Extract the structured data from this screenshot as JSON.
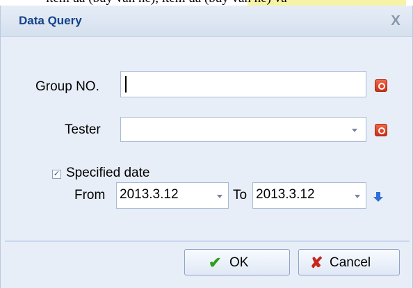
{
  "background_text": "ltem ua (buy van ne), ltem ua (buy van ne) va",
  "dialog": {
    "title": "Data Query",
    "close_glyph": "X"
  },
  "form": {
    "group_no": {
      "label": "Group NO.",
      "value": "",
      "clear_icon": "clear-icon"
    },
    "tester": {
      "label": "Tester",
      "value": "",
      "dropdown_icon": "chevron-down-icon",
      "clear_icon": "clear-icon"
    },
    "specified_date": {
      "label": "Specified date",
      "checked": true,
      "check_glyph": "✓",
      "from_label": "From",
      "from_value": "2013.3.12",
      "to_label": "To",
      "to_value": "2013.3.12",
      "apply_icon": "arrow-down-icon"
    }
  },
  "footer": {
    "ok_label": "OK",
    "ok_glyph": "✔",
    "cancel_label": "Cancel",
    "cancel_glyph": "✘"
  },
  "colors": {
    "title": "#15428b",
    "dialog_bg": "#e8eef7",
    "clear_button": "#e0452a",
    "ok_check": "#2e9e1a",
    "cancel_x": "#c8261b",
    "separator": "#8fb0de"
  }
}
